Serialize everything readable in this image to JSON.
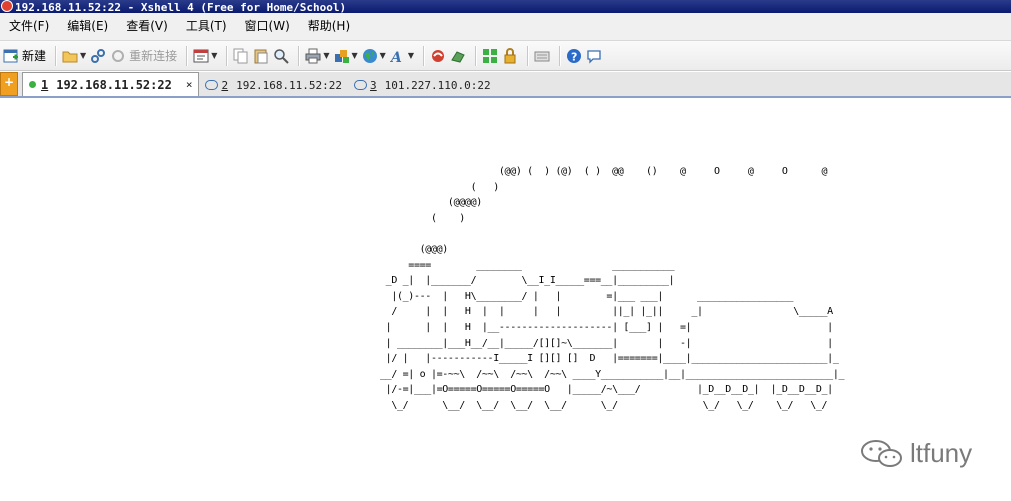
{
  "window": {
    "title": "192.168.11.52:22 - Xshell 4 (Free for Home/School)"
  },
  "menu": [
    {
      "label": "文件(F)"
    },
    {
      "label": "编辑(E)"
    },
    {
      "label": "查看(V)"
    },
    {
      "label": "工具(T)"
    },
    {
      "label": "窗口(W)"
    },
    {
      "label": "帮助(H)"
    }
  ],
  "toolbar": {
    "new_label": "新建",
    "reconnect_label": "重新连接"
  },
  "tabs": [
    {
      "number": "1",
      "label": "192.168.11.52:22",
      "status": "connected"
    },
    {
      "number": "2",
      "label": "192.168.11.52:22"
    },
    {
      "number": "3",
      "label": "101.227.110.0:22"
    }
  ],
  "terminal": {
    "ascii_art": "                     (@@) (  ) (@)  ( )  @@    ()    @     O     @     O      @\n                (   )\n            (@@@@)\n         (    )\n\n       (@@@)\n     ====        ________                ___________\n _D _|  |_______/        \\__I_I_____===__|_________|\n  |(_)---  |   H\\________/ |   |        =|___ ___|      _________________\n  /     |  |   H  |  |     |   |         ||_| |_||     _|                \\_____A\n |      |  |   H  |__--------------------| [___] |   =|                        |\n | ________|___H__/__|_____/[][]~\\_______|       |   -|                        |\n |/ |   |-----------I_____I [][] []  D   |=======|____|________________________|_\n__/ =| o |=-~~\\  /~~\\  /~~\\  /~~\\ ____Y___________|__|__________________________|_\n |/-=|___|=O=====O=====O=====O   |_____/~\\___/          |_D__D__D_|  |_D__D__D_|\n  \\_/      \\__/  \\__/  \\__/  \\__/      \\_/               \\_/   \\_/    \\_/   \\_/"
  },
  "watermark": {
    "text": "ltfuny"
  },
  "colors": {
    "titlebar": "#0a1a6e",
    "connected_dot": "#3cb043",
    "tab_accent": "#8aa0c8"
  }
}
